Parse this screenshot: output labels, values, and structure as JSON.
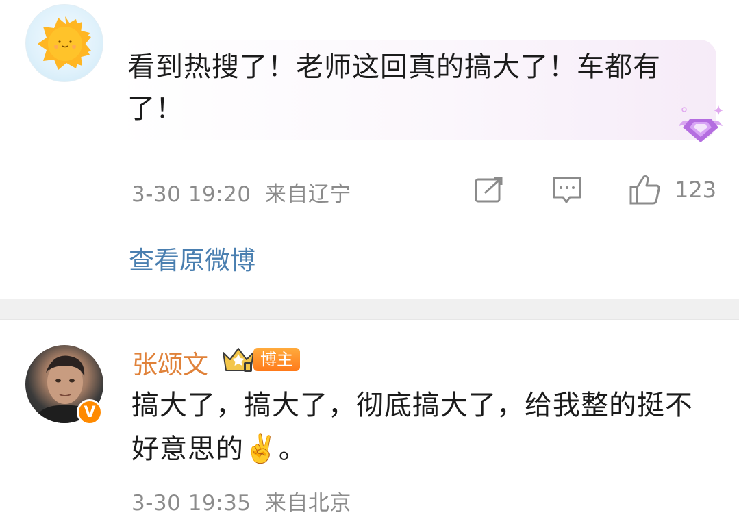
{
  "comment1": {
    "avatar": "sun-avatar",
    "text": "看到热搜了！老师这回真的搞大了！车都有了！",
    "time": "3-30 19:20",
    "location": "来自辽宁",
    "like_count": "123",
    "view_original": "查看原微博",
    "badge_icon": "purple-gem-badge",
    "accent_color": "#4a7fb0"
  },
  "reply": {
    "username": "张颂文",
    "role_badge": "博主",
    "text": "搞大了，搞大了，彻底搞大了，给我整的挺不好意思的✌️。",
    "time": "3-30 19:35",
    "location": "来自北京",
    "verified_badge": "V",
    "name_color": "#e0823a"
  }
}
